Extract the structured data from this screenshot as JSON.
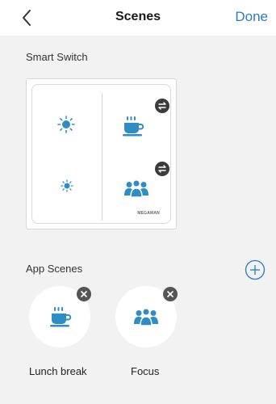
{
  "header": {
    "title": "Scenes",
    "done_label": "Done"
  },
  "smart_switch": {
    "section_title": "Smart Switch",
    "brand": "MEGAMAN",
    "buttons": [
      {
        "position": "top-left",
        "icon": "sun-large-icon",
        "badge": ""
      },
      {
        "position": "top-right",
        "icon": "coffee-cup-icon",
        "badge": "swap-icon"
      },
      {
        "position": "bottom-left",
        "icon": "sun-small-icon",
        "badge": ""
      },
      {
        "position": "bottom-right",
        "icon": "people-group-icon",
        "badge": "swap-icon"
      }
    ]
  },
  "app_scenes": {
    "section_title": "App Scenes",
    "items": [
      {
        "label": "Lunch break",
        "icon": "coffee-cup-icon"
      },
      {
        "label": "Focus",
        "icon": "people-group-icon"
      }
    ]
  },
  "colors": {
    "accent": "#2a7bc2",
    "icon_blue": "#2f8dc6",
    "badge_dark": "#3c3c3c",
    "background": "#f2f2f2"
  }
}
